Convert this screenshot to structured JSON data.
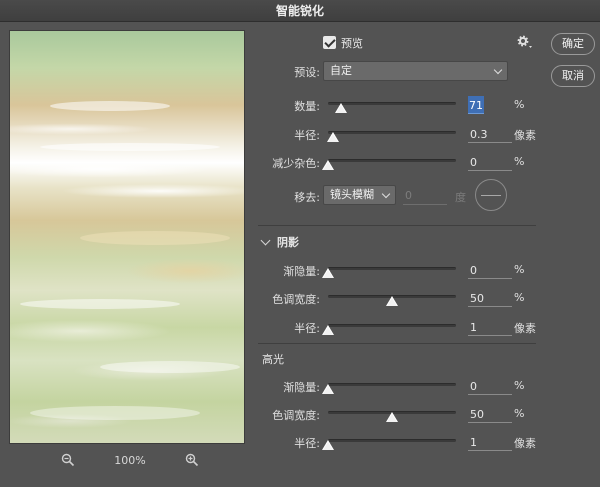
{
  "window": {
    "title": "智能锐化"
  },
  "preview_panel": {
    "zoom_level": "100%"
  },
  "options": {
    "preview_label": "预览",
    "preview_checked": true,
    "preset_label": "预设:",
    "preset_value": "自定"
  },
  "buttons": {
    "ok": "确定",
    "cancel": "取消"
  },
  "main": {
    "amount": {
      "label": "数量:",
      "value": "71",
      "unit": "%",
      "level": 0.1
    },
    "radius": {
      "label": "半径:",
      "value": "0.3",
      "unit": "像素",
      "level": 0.04
    },
    "reduce_noise": {
      "label": "减少杂色:",
      "value": "0",
      "unit": "%",
      "level": 0.0
    },
    "remove": {
      "label": "移去:",
      "value": "镜头模糊",
      "angle": "0",
      "angle_unit": "度"
    }
  },
  "shadows": {
    "heading": "阴影",
    "fade_amount": {
      "label": "渐隐量:",
      "value": "0",
      "unit": "%",
      "level": 0.0
    },
    "tonal_width": {
      "label": "色调宽度:",
      "value": "50",
      "unit": "%",
      "level": 0.5
    },
    "radius": {
      "label": "半径:",
      "value": "1",
      "unit": "像素",
      "level": 0.0
    }
  },
  "highlights": {
    "heading": "高光",
    "fade_amount": {
      "label": "渐隐量:",
      "value": "0",
      "unit": "%",
      "level": 0.0
    },
    "tonal_width": {
      "label": "色调宽度:",
      "value": "50",
      "unit": "%",
      "level": 0.5
    },
    "radius": {
      "label": "半径:",
      "value": "1",
      "unit": "像素",
      "level": 0.0
    }
  },
  "icons": {
    "zoom_out": "zoom-out-icon",
    "zoom_in": "zoom-in-icon",
    "settings": "gear-icon"
  },
  "colors": {
    "background": "#535353",
    "field_highlight": "#3f6fb5"
  }
}
